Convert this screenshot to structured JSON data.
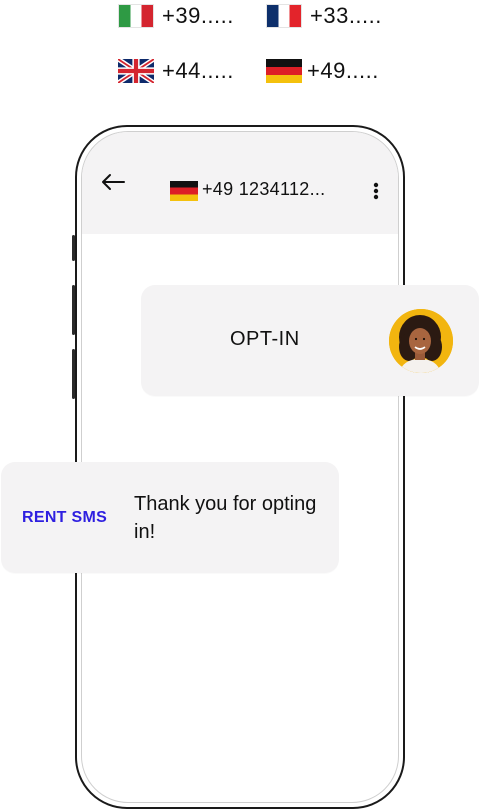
{
  "country_codes": [
    {
      "country": "Italy",
      "code": "+39....."
    },
    {
      "country": "France",
      "code": "+33....."
    },
    {
      "country": "United Kingdom",
      "code": "+44....."
    },
    {
      "country": "Germany",
      "code": "+49....."
    }
  ],
  "chat": {
    "header": {
      "back_icon": "arrow-left-icon",
      "flag_icon": "germany-flag-icon",
      "phone_number": "+49 1234112...",
      "menu_icon": "more-vertical-icon",
      "background": "#f4f3f4"
    },
    "messages": [
      {
        "from": "user",
        "text": "OPT-IN",
        "avatar": "woman-avatar-icon"
      },
      {
        "from": "sender",
        "sender_name": "RENT SMS",
        "text": "Thank you for opting in!"
      }
    ]
  },
  "colors": {
    "brand": "#2e1fe0",
    "avatar_bg": "#f2b50f",
    "bubble_bg": "#f4f3f4"
  }
}
